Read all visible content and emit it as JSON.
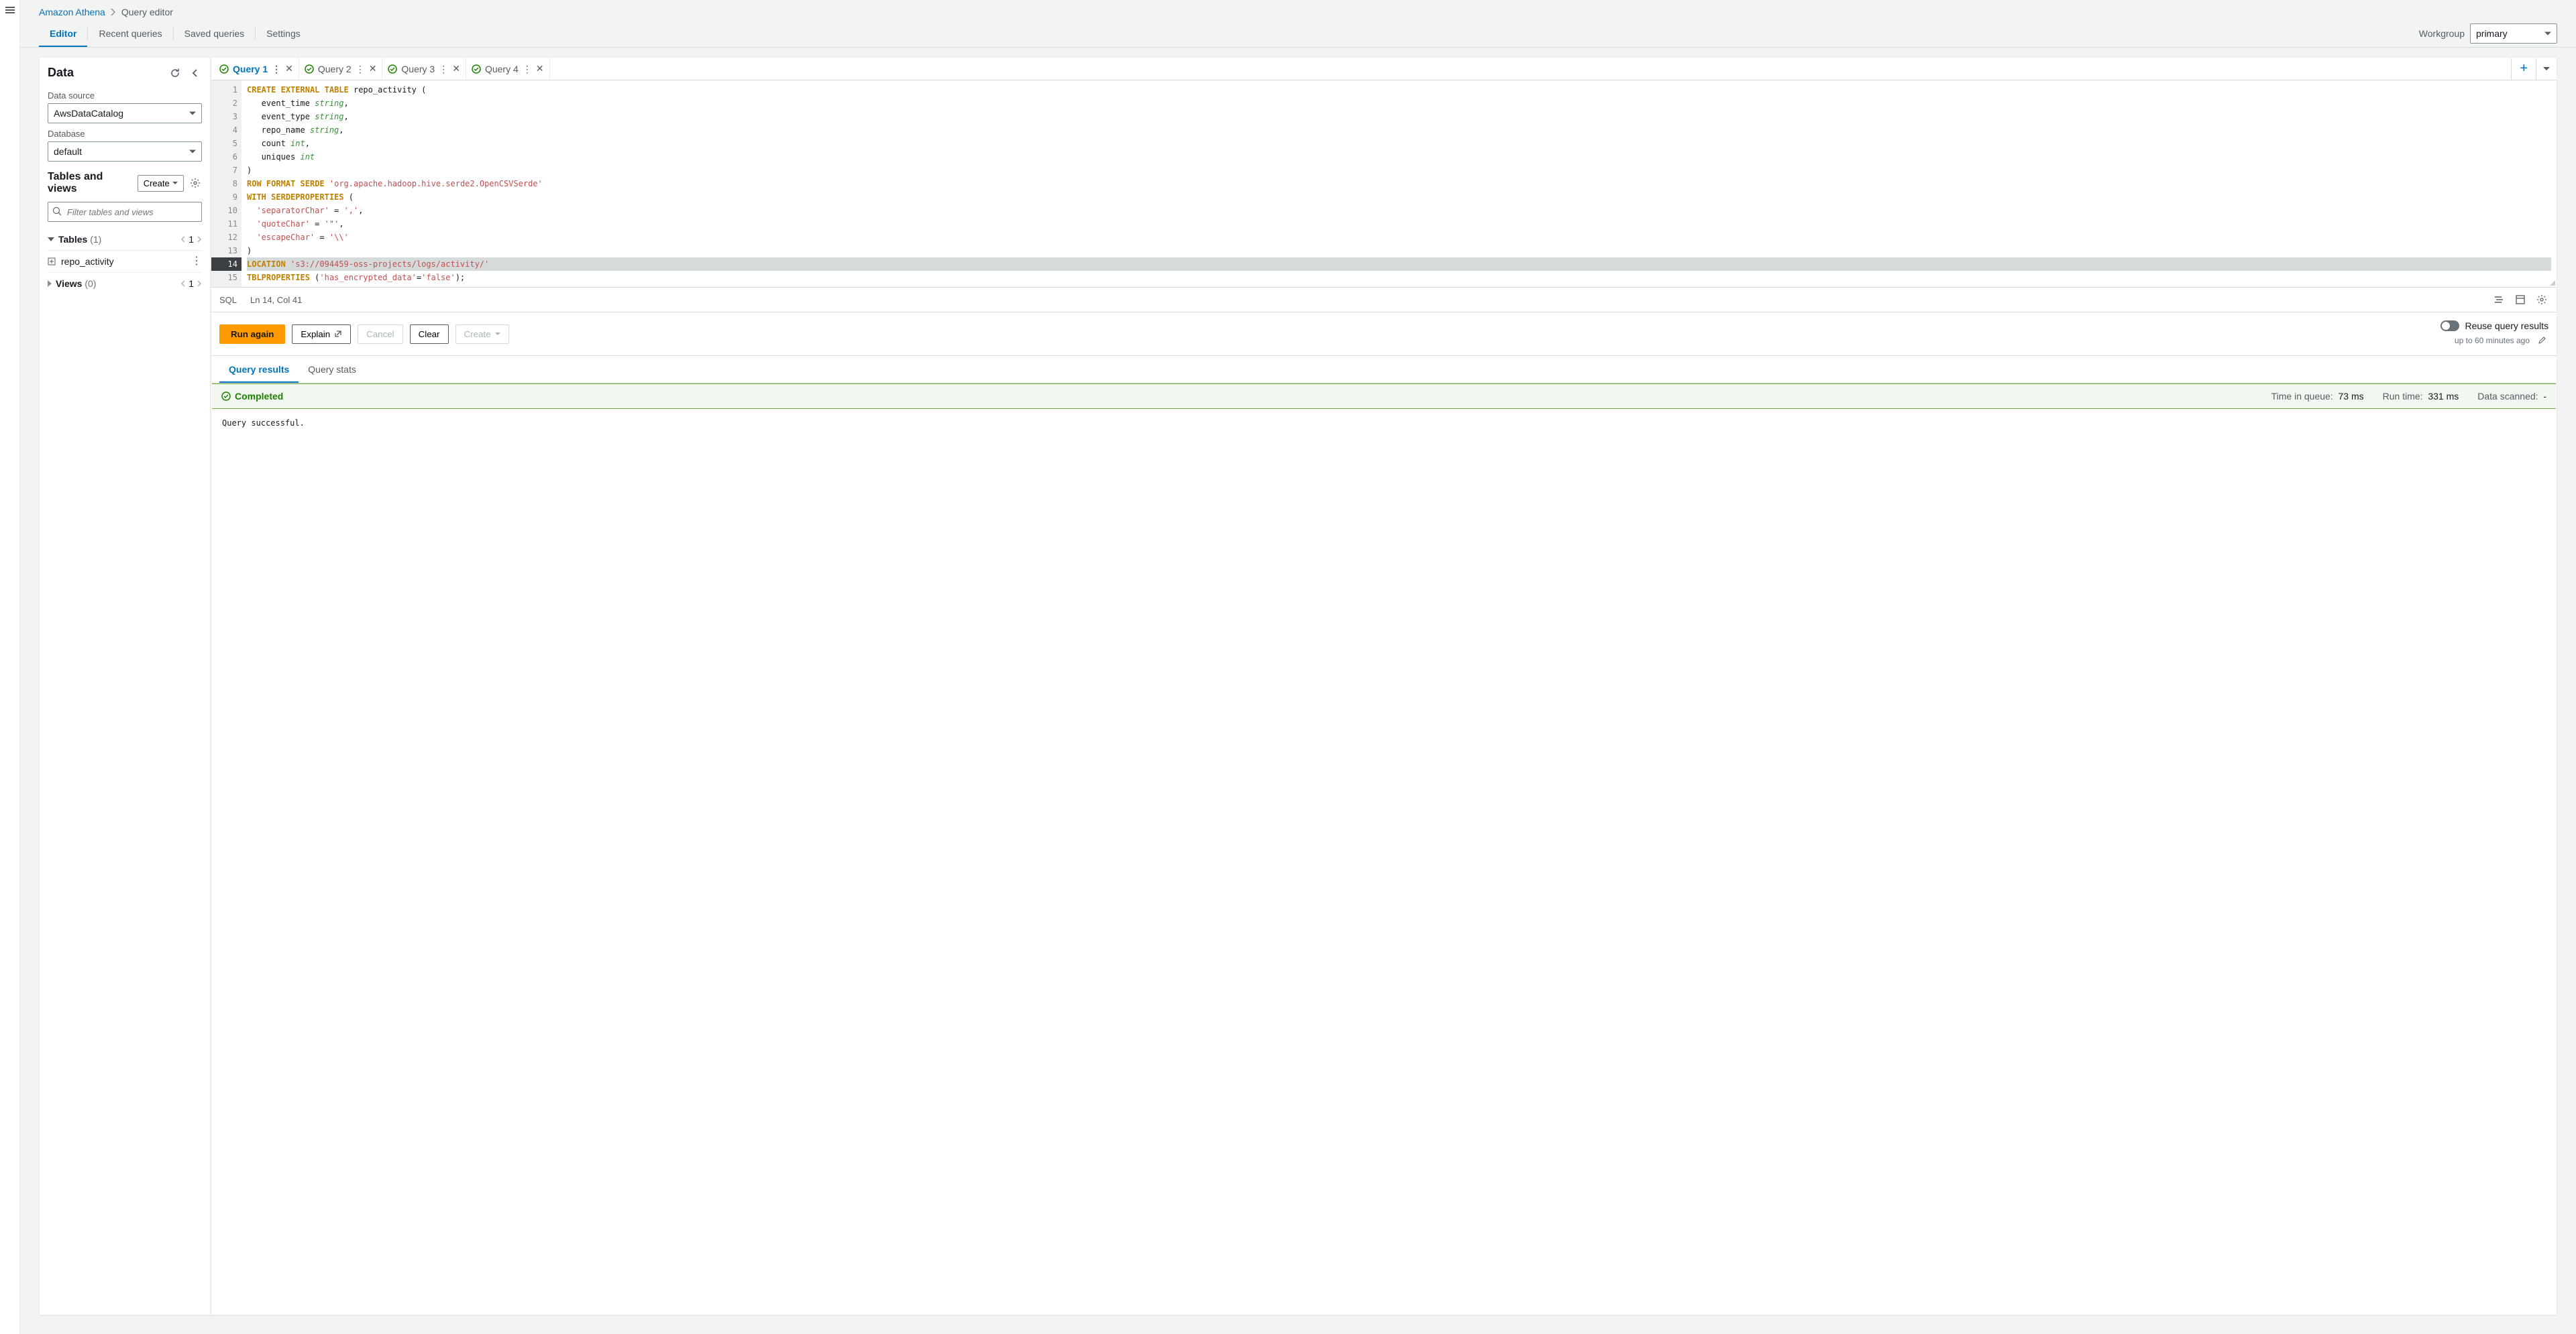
{
  "breadcrumb": {
    "service": "Amazon Athena",
    "page": "Query editor"
  },
  "tabs": {
    "editor": "Editor",
    "recent": "Recent queries",
    "saved": "Saved queries",
    "settings": "Settings"
  },
  "workgroup": {
    "label": "Workgroup",
    "value": "primary"
  },
  "sidebar": {
    "title": "Data",
    "data_source_label": "Data source",
    "data_source_value": "AwsDataCatalog",
    "database_label": "Database",
    "database_value": "default",
    "tv_title": "Tables and views",
    "create_label": "Create",
    "filter_placeholder": "Filter tables and views",
    "tables_label": "Tables",
    "tables_count": "(1)",
    "tables_page": "1",
    "table_item": "repo_activity",
    "views_label": "Views",
    "views_count": "(0)",
    "views_page": "1"
  },
  "query_tabs": [
    "Query 1",
    "Query 2",
    "Query 3",
    "Query 4"
  ],
  "code_lines": [
    "CREATE EXTERNAL TABLE repo_activity (",
    "   event_time string,",
    "   event_type string,",
    "   repo_name string,",
    "   count int,",
    "   uniques int",
    ")",
    "ROW FORMAT SERDE 'org.apache.hadoop.hive.serde2.OpenCSVSerde'",
    "WITH SERDEPROPERTIES (",
    "  'separatorChar' = ',',",
    "  'quoteChar' = '\"',",
    "  'escapeChar' = '\\\\'",
    ")",
    "LOCATION 's3://094459-oss-projects/logs/activity/'",
    "TBLPROPERTIES ('has_encrypted_data'='false');"
  ],
  "status": {
    "lang": "SQL",
    "pos": "Ln 14, Col 41"
  },
  "actions": {
    "run": "Run again",
    "explain": "Explain",
    "cancel": "Cancel",
    "clear": "Clear",
    "create": "Create"
  },
  "reuse": {
    "label": "Reuse query results",
    "sub": "up to 60 minutes ago"
  },
  "sub_tabs": {
    "results": "Query results",
    "stats": "Query stats"
  },
  "banner": {
    "status": "Completed",
    "queue_label": "Time in queue:",
    "queue_val": "73 ms",
    "run_label": "Run time:",
    "run_val": "331 ms",
    "scan_label": "Data scanned:",
    "scan_val": "-"
  },
  "result_text": "Query successful."
}
